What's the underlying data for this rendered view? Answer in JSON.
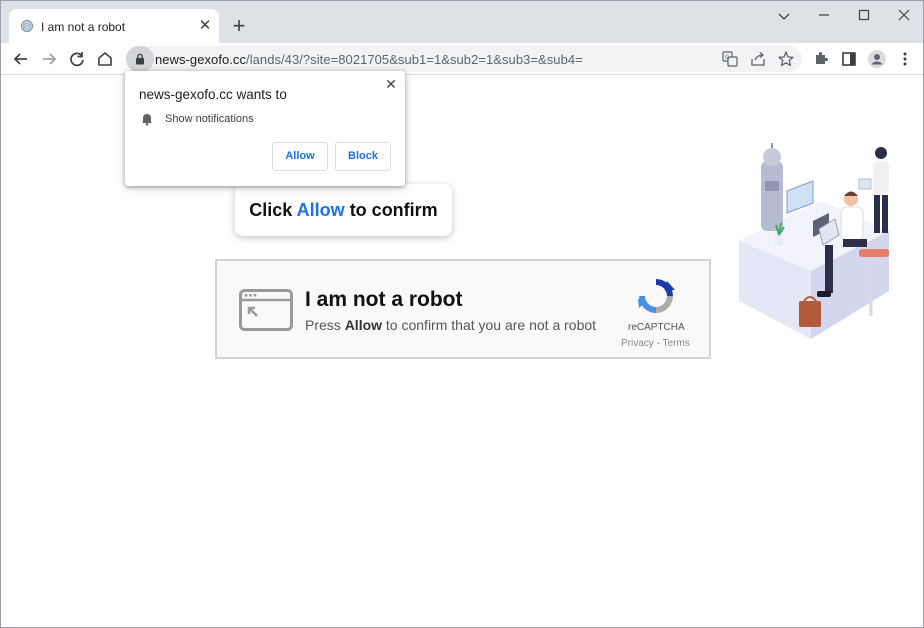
{
  "browser": {
    "tab": {
      "title": "I am not a robot",
      "close_glyph": "✕",
      "favicon": "robot-favicon-icon"
    },
    "new_tab_glyph": "+",
    "window_controls": {
      "dropdown": "chevron-down-icon",
      "minimize": "minimize-icon",
      "maximize": "maximize-icon",
      "close": "close-icon"
    },
    "address_bar": {
      "host": "news-gexofo.cc",
      "path": "/lands/43/?site=8021705&sub1=1&sub2=1&sub3=&sub4="
    },
    "toolbar_icons": [
      "back-icon",
      "forward-icon",
      "reload-icon",
      "home-icon",
      "translate-icon",
      "share-icon",
      "bookmark-star-icon",
      "extensions-icon",
      "side-panel-icon",
      "profile-icon",
      "menu-icon"
    ]
  },
  "permission_popup": {
    "title": "news-gexofo.cc wants to",
    "item": "Show notifications",
    "allow_label": "Allow",
    "block_label": "Block",
    "close_glyph": "✕"
  },
  "page": {
    "click_prefix": "Click",
    "click_highlight": "Allow",
    "click_suffix": "to confirm",
    "captcha": {
      "title": "I am not a robot",
      "sub_prefix": "Press",
      "sub_bold": "Allow",
      "sub_suffix": "to confirm that you are not a robot",
      "brand": "reCAPTCHA",
      "links": "Privacy - Terms"
    }
  },
  "colors": {
    "accent": "#1a73e8",
    "tabstrip": "#dee1e6",
    "omnibox": "#f1f3f4"
  }
}
